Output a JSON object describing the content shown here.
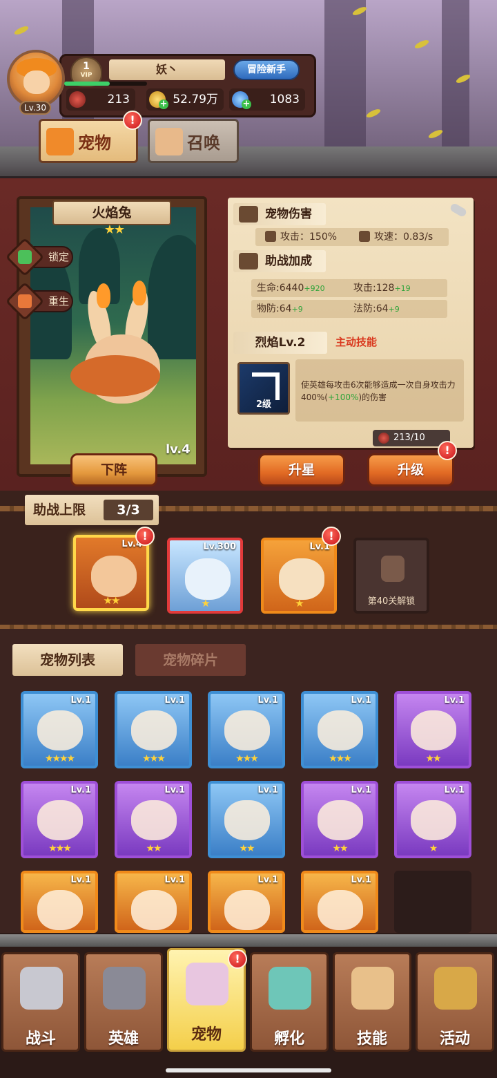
{
  "colors": {
    "accent_orange": "#e26b24",
    "panel_parchment": "#f3e3c3",
    "bonus_green": "#2fa43a",
    "skill_type_red": "#d9381e",
    "alert_red": "#c8121a"
  },
  "player": {
    "level": "Lv.30",
    "vip_level": "1",
    "vip_label": "VIP",
    "name": "妖丶",
    "title_badge": "冒险新手",
    "xp_fraction": 0.55
  },
  "resources": {
    "ruby": {
      "value": "213",
      "icon": "ruby-icon"
    },
    "gold": {
      "value": "52.79万",
      "icon": "gold-coin-icon"
    },
    "gem": {
      "value": "1083",
      "icon": "diamond-icon"
    }
  },
  "top_tabs": {
    "pet": {
      "label": "宠物",
      "icon": "fox-icon",
      "alert": "!"
    },
    "summon": {
      "label": "召唤",
      "icon": "paw-icon"
    }
  },
  "pet": {
    "name": "火焰兔",
    "stars": "★★",
    "level": "lv.4",
    "lock_label": "锁定",
    "rebirth_label": "重生",
    "unequip_label": "下阵"
  },
  "info": {
    "damage_header": "宠物伤害",
    "attack": "攻击：150%",
    "attack_speed": "攻速：0.83/s",
    "assist_header": "助战加成",
    "hp": "生命:6440",
    "hp_bonus": "+920",
    "atk": "攻击:128",
    "atk_bonus": "+19",
    "pdef": "物防:64",
    "pdef_bonus": "+9",
    "mdef": "法防:64",
    "mdef_bonus": "+9",
    "skill_name": "烈焰Lv.2",
    "skill_type": "主动技能",
    "skill_icon_level": "2级",
    "skill_desc_1": "使英雄每攻击6次能够造成一次自身攻击力400%(",
    "skill_desc_bonus": "+100%",
    "skill_desc_2": ")的伤害",
    "shard_count": "213/10",
    "star_up_label": "升星",
    "level_up_label": "升级",
    "alert": "!"
  },
  "helper": {
    "title": "助战上限",
    "count": "3/3",
    "slots": [
      {
        "level": "Lv.4",
        "stars": "★★",
        "alert": "!"
      },
      {
        "level": "Lv.300",
        "stars": "★"
      },
      {
        "level": "Lv.1",
        "stars": "★",
        "alert": "!"
      }
    ],
    "locked_label": "第40关解锁"
  },
  "list_tabs": {
    "pets": "宠物列表",
    "shards": "宠物碎片"
  },
  "pet_list": [
    {
      "level": "Lv.1",
      "stars": "★★★★",
      "rarity": "blue"
    },
    {
      "level": "Lv.1",
      "stars": "★★★",
      "rarity": "blue"
    },
    {
      "level": "Lv.1",
      "stars": "★★★",
      "rarity": "blue"
    },
    {
      "level": "Lv.1",
      "stars": "★★★",
      "rarity": "blue"
    },
    {
      "level": "Lv.1",
      "stars": "★★",
      "rarity": "purple"
    },
    {
      "level": "Lv.1",
      "stars": "★★★",
      "rarity": "purple"
    },
    {
      "level": "Lv.1",
      "stars": "★★",
      "rarity": "purple"
    },
    {
      "level": "Lv.1",
      "stars": "★★",
      "rarity": "blue"
    },
    {
      "level": "Lv.1",
      "stars": "★★",
      "rarity": "purple"
    },
    {
      "level": "Lv.1",
      "stars": "★",
      "rarity": "purple"
    },
    {
      "level": "Lv.1",
      "stars": "",
      "rarity": "orange"
    },
    {
      "level": "Lv.1",
      "stars": "",
      "rarity": "orange"
    },
    {
      "level": "Lv.1",
      "stars": "",
      "rarity": "orange"
    },
    {
      "level": "Lv.1",
      "stars": "",
      "rarity": "orange"
    }
  ],
  "nav": [
    {
      "label": "战斗",
      "icon": "crossed-swords-icon"
    },
    {
      "label": "英雄",
      "icon": "knight-helmet-icon"
    },
    {
      "label": "宠物",
      "icon": "winged-heart-icon",
      "alert": "!"
    },
    {
      "label": "孵化",
      "icon": "egg-icon"
    },
    {
      "label": "技能",
      "icon": "spellbook-icon"
    },
    {
      "label": "活动",
      "icon": "treasure-scroll-icon"
    }
  ]
}
